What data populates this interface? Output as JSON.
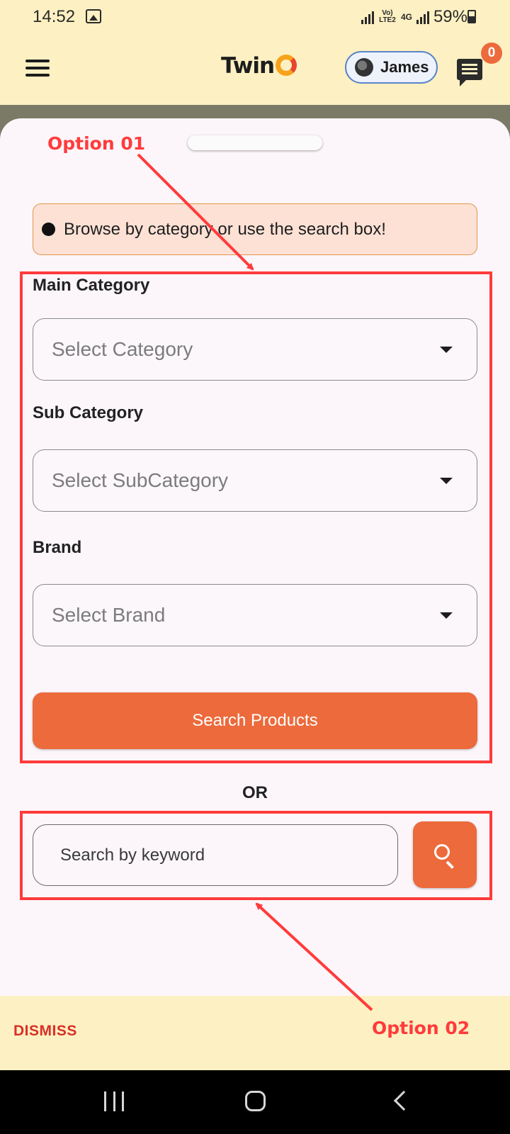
{
  "status_bar": {
    "time": "14:52",
    "network_label": "Vo) LTE2",
    "network_type": "4G",
    "battery": "59%"
  },
  "appbar": {
    "logo_text": "Twin",
    "user_name": "James",
    "notification_count": "0"
  },
  "notice": {
    "text": "Browse by category or use the search box!"
  },
  "filters": {
    "main_category_label": "Main Category",
    "main_category_placeholder": "Select Category",
    "sub_category_label": "Sub Category",
    "sub_category_placeholder": "Select SubCategory",
    "brand_label": "Brand",
    "brand_placeholder": "Select Brand",
    "search_button": "Search Products"
  },
  "separator": "OR",
  "keyword_search": {
    "placeholder": "Search by keyword"
  },
  "footer": {
    "dismiss_label": "DISMISS"
  },
  "annotations": {
    "option1": "Option 01",
    "option2": "Option 02",
    "color": "#ff3b3b"
  },
  "colors": {
    "accent": "#ec6a3b",
    "background": "#fdf0c2",
    "sheet": "#fcf6fb",
    "dismiss": "#d83028"
  }
}
